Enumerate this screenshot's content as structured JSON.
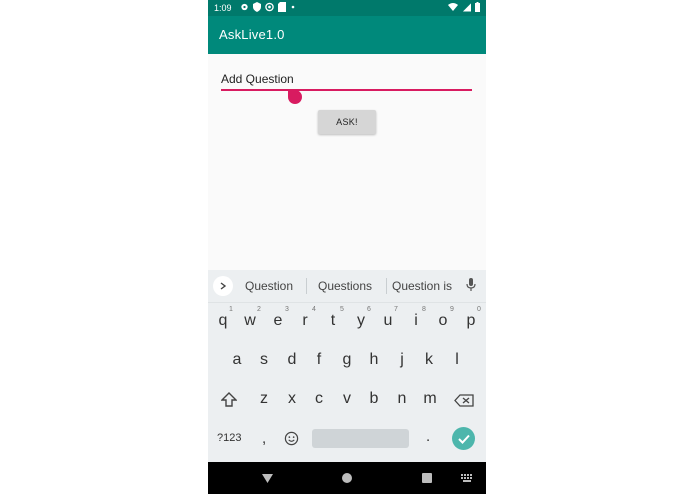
{
  "status_bar": {
    "time": "1:09"
  },
  "app_bar": {
    "title": "AskLive1.0"
  },
  "question_input": {
    "value": "Add Question"
  },
  "ask_button": {
    "label": "ASK!"
  },
  "keyboard": {
    "suggestions": [
      "Question",
      "Questions",
      "Question is"
    ],
    "row1": [
      "q",
      "w",
      "e",
      "r",
      "t",
      "y",
      "u",
      "i",
      "o",
      "p"
    ],
    "row1_hints": [
      "1",
      "2",
      "3",
      "4",
      "5",
      "6",
      "7",
      "8",
      "9",
      "0"
    ],
    "row2": [
      "a",
      "s",
      "d",
      "f",
      "g",
      "h",
      "j",
      "k",
      "l"
    ],
    "row3": [
      "z",
      "x",
      "c",
      "v",
      "b",
      "n",
      "m"
    ],
    "symbols_label": "?123",
    "comma": ",",
    "period": "."
  },
  "colors": {
    "status_bar": "#00796b",
    "app_bar": "#00897b",
    "accent": "#d81b60",
    "enter_key": "#4db6ac"
  },
  "icons": {
    "status_left": [
      "settings-icon",
      "shield-icon",
      "sync-icon",
      "sd-card-icon",
      "dot-icon"
    ],
    "status_right": [
      "wifi-icon",
      "signal-icon",
      "battery-icon"
    ],
    "nav": [
      "back-icon",
      "home-icon",
      "recents-icon",
      "keyboard-switch-icon"
    ]
  }
}
